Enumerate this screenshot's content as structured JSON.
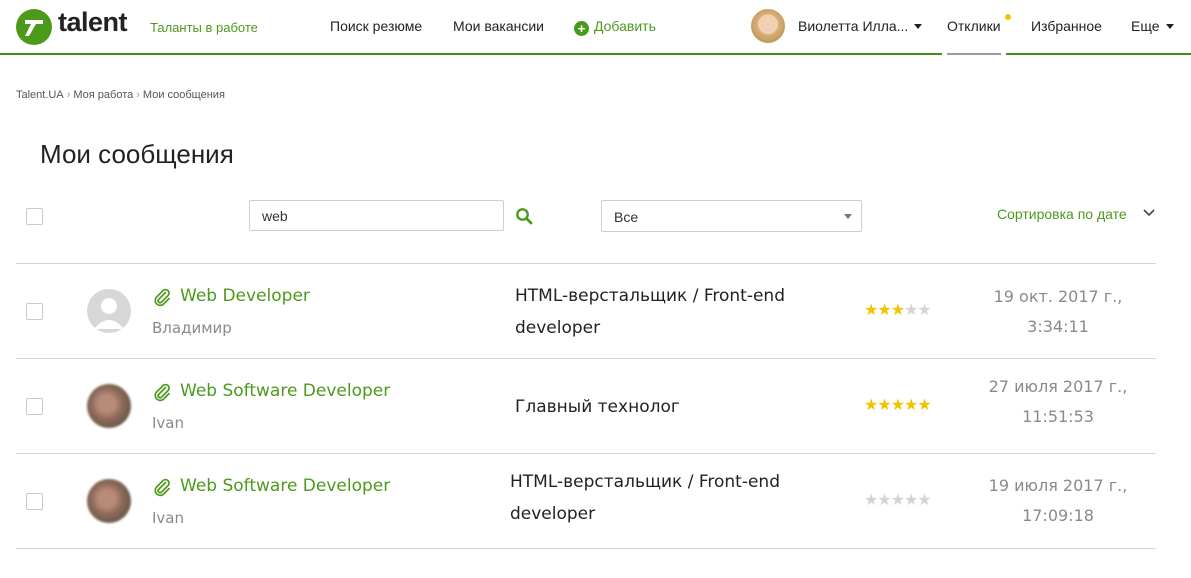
{
  "header": {
    "logo_text": "talent",
    "tagline": "Таланты в работе",
    "nav": {
      "search_resumes": "Поиск резюме",
      "my_vacancies": "Мои вакансии",
      "add": "Добавить"
    },
    "user_name": "Виолетта Илла...",
    "responses": "Отклики",
    "favorites": "Избранное",
    "more": "Еще"
  },
  "breadcrumb": [
    "Talent.UA",
    "Моя работа",
    "Мои сообщения"
  ],
  "page_title": "Мои сообщения",
  "toolbar": {
    "search_value": "web",
    "filter_value": "Все",
    "sort_label": "Сортировка по дате"
  },
  "messages": [
    {
      "vacancy": "Web Developer",
      "sender": "Владимир",
      "resume_line1": "HTML-верстальщик / Front-end",
      "resume_line2": "developer",
      "rating": 3,
      "date": "19 окт. 2017 г.,",
      "time": "3:34:11",
      "avatar": "default-avatar"
    },
    {
      "vacancy": "Web Software Developer",
      "sender": "Ivan",
      "resume_line1": "Главный технолог",
      "resume_line2": "",
      "rating": 5,
      "date": "27 июля 2017 г.,",
      "time": "11:51:53",
      "avatar": "photo-avatar"
    },
    {
      "vacancy": "Web Software Developer",
      "sender": "Ivan",
      "resume_line1": "HTML-верстальщик / Front-end",
      "resume_line2": "developer",
      "rating": 0,
      "date": "19 июля 2017 г.,",
      "time": "17:09:18",
      "avatar": "photo-avatar"
    }
  ],
  "colors": {
    "brand_green": "#4c9a1c",
    "star_active": "#f2c400",
    "star_inactive": "#d4d4d4"
  }
}
